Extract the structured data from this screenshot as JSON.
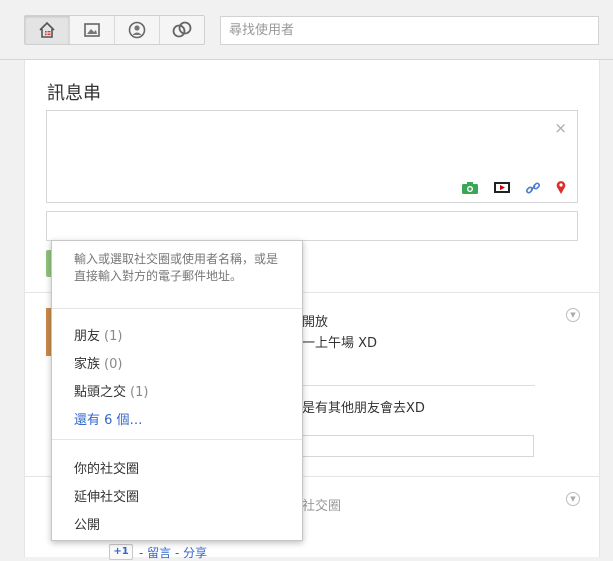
{
  "toolbar": {
    "nav": [
      {
        "name": "home-icon"
      },
      {
        "name": "photos-icon"
      },
      {
        "name": "profile-icon"
      },
      {
        "name": "circles-icon"
      }
    ],
    "search_placeholder": "尋找使用者"
  },
  "stream": {
    "title": "訊息串",
    "composer_close": "×"
  },
  "background_posts": {
    "post1_line1": "開放",
    "post1_line2": "一上午場 XD",
    "post1_comment": "是有其他朋友會去XD",
    "post2_line1": "社交圈",
    "plus_one": "+1",
    "actions": "- 留言 - 分享"
  },
  "circle_picker": {
    "hint": "輸入或選取社交圈或使用者名稱，或是直接輸入對方的電子郵件地址。",
    "circles": [
      {
        "label": "朋友",
        "count": "(1)"
      },
      {
        "label": "家族",
        "count": "(0)"
      },
      {
        "label": "點頭之交",
        "count": "(1)"
      }
    ],
    "more": "還有 6 個…",
    "options": [
      "你的社交圈",
      "延伸社交圈",
      "公開"
    ]
  }
}
